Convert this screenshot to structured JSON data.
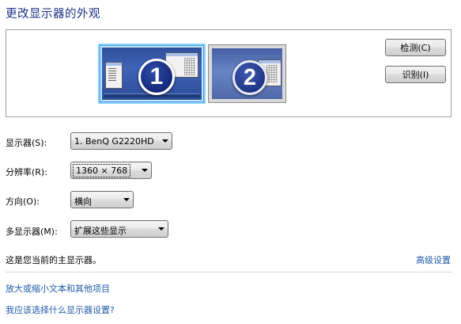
{
  "title": "更改显示器的外观",
  "preview": {
    "monitor1": {
      "number": "1",
      "selected": true
    },
    "monitor2": {
      "number": "2",
      "selected": false
    },
    "buttons": {
      "detect": "检测(C)",
      "identify": "识别(I)"
    }
  },
  "settings": {
    "display": {
      "label": "显示器(S):",
      "value": "1. BenQ G2220HD"
    },
    "resolution": {
      "label": "分辨率(R):",
      "value": "1360 × 768"
    },
    "orientation": {
      "label": "方向(O):",
      "value": "横向"
    },
    "multiple_displays": {
      "label": "多显示器(M):",
      "value": "扩展这些显示"
    }
  },
  "status_text": "这是您当前的主显示器。",
  "links": {
    "advanced": "高级设置",
    "text_size": "放大或缩小文本和其他项目",
    "help": "我应该选择什么显示器设置?"
  },
  "colors": {
    "title": "#1e3287",
    "link": "#1e5aa8",
    "selection_border": "#8ad1ff",
    "badge_fill": "#1e3587"
  }
}
